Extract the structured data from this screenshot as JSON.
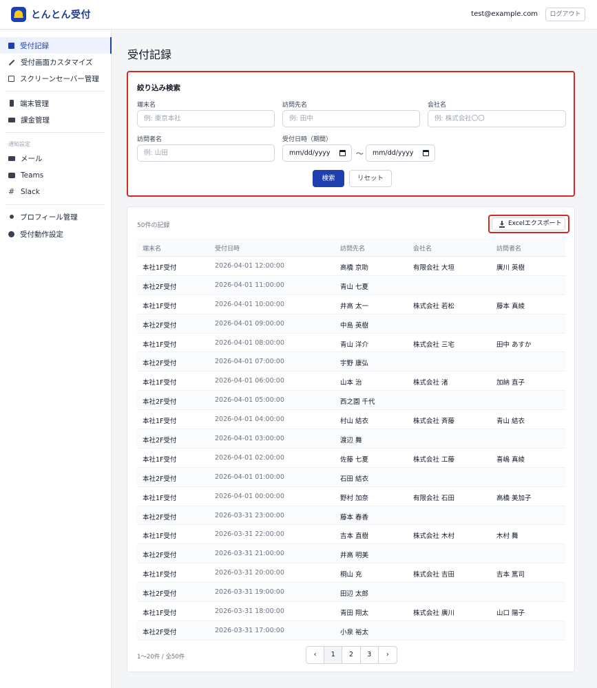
{
  "header": {
    "app_title": "とんとん受付",
    "user_email": "test@example.com",
    "logout_label": "ログアウト"
  },
  "sidebar": {
    "items": [
      {
        "label": "受付記録",
        "icon": "clipboard-icon",
        "active": true
      },
      {
        "label": "受付画面カスタマイズ",
        "icon": "pencil-icon"
      },
      {
        "label": "スクリーンセーバー管理",
        "icon": "image-icon"
      },
      {
        "label": "端末管理",
        "icon": "phone-icon"
      },
      {
        "label": "課金管理",
        "icon": "credit-card-icon"
      },
      {
        "label": "メール",
        "icon": "mail-icon"
      },
      {
        "label": "Teams",
        "icon": "chat-icon"
      },
      {
        "label": "Slack",
        "icon": "hash-icon"
      },
      {
        "label": "プロフィール管理",
        "icon": "user-icon"
      },
      {
        "label": "受付動作設定",
        "icon": "gear-icon"
      }
    ],
    "section_notify": "通知設定"
  },
  "main": {
    "page_title": "受付記録"
  },
  "filter": {
    "title": "絞り込み検索",
    "terminal_label": "端末名",
    "terminal_placeholder": "例: 東京本社",
    "visit_to_label": "訪問先名",
    "visit_to_placeholder": "例: 田中",
    "company_label": "会社名",
    "company_placeholder": "例: 株式会社〇〇",
    "visitor_label": "訪問者名",
    "visitor_placeholder": "例: 山田",
    "date_label": "受付日時（期間）",
    "date_from": "mm/dd/yyyy",
    "date_to": "mm/dd/yyyy",
    "tilde": "〜",
    "search_label": "検索",
    "reset_label": "リセット"
  },
  "table": {
    "record_count": "50件の記録",
    "export_label": "Excelエクスポート",
    "columns": [
      "端末名",
      "受付日時",
      "訪問先名",
      "会社名",
      "訪問者名"
    ],
    "rows": [
      [
        "本社1F受付",
        "2026-04-01 12:00:00",
        "高橋 京助",
        "有限会社 大垣",
        "廣川 英樹"
      ],
      [
        "本社2F受付",
        "2026-04-01 11:00:00",
        "青山 七夏",
        "",
        ""
      ],
      [
        "本社1F受付",
        "2026-04-01 10:00:00",
        "井高 太一",
        "株式会社 若松",
        "藤本 真綾"
      ],
      [
        "本社2F受付",
        "2026-04-01 09:00:00",
        "中島 英樹",
        "",
        ""
      ],
      [
        "本社1F受付",
        "2026-04-01 08:00:00",
        "青山 洋介",
        "株式会社 三宅",
        "田中 あすか"
      ],
      [
        "本社2F受付",
        "2026-04-01 07:00:00",
        "宇野 康弘",
        "",
        ""
      ],
      [
        "本社1F受付",
        "2026-04-01 06:00:00",
        "山本 治",
        "株式会社 渚",
        "加納 直子"
      ],
      [
        "本社2F受付",
        "2026-04-01 05:00:00",
        "西之園 千代",
        "",
        ""
      ],
      [
        "本社1F受付",
        "2026-04-01 04:00:00",
        "村山 結衣",
        "株式会社 斉藤",
        "青山 結衣"
      ],
      [
        "本社2F受付",
        "2026-04-01 03:00:00",
        "渡辺 舞",
        "",
        ""
      ],
      [
        "本社1F受付",
        "2026-04-01 02:00:00",
        "佐藤 七夏",
        "株式会社 工藤",
        "喜嶋 真綾"
      ],
      [
        "本社2F受付",
        "2026-04-01 01:00:00",
        "石田 結衣",
        "",
        ""
      ],
      [
        "本社1F受付",
        "2026-04-01 00:00:00",
        "野村 加奈",
        "有限会社 石田",
        "高橋 美加子"
      ],
      [
        "本社2F受付",
        "2026-03-31 23:00:00",
        "藤本 春香",
        "",
        ""
      ],
      [
        "本社1F受付",
        "2026-03-31 22:00:00",
        "吉本 直樹",
        "株式会社 木村",
        "木村 舞"
      ],
      [
        "本社2F受付",
        "2026-03-31 21:00:00",
        "井高 明美",
        "",
        ""
      ],
      [
        "本社1F受付",
        "2026-03-31 20:00:00",
        "桐山 充",
        "株式会社 吉田",
        "吉本 篤司"
      ],
      [
        "本社2F受付",
        "2026-03-31 19:00:00",
        "田辺 太郎",
        "",
        ""
      ],
      [
        "本社1F受付",
        "2026-03-31 18:00:00",
        "青田 翔太",
        "株式会社 廣川",
        "山口 陽子"
      ],
      [
        "本社2F受付",
        "2026-03-31 17:00:00",
        "小泉 裕太",
        "",
        ""
      ]
    ],
    "page_info": "1〜20件 / 全50件",
    "pagination": {
      "prev": "‹",
      "pages": [
        "1",
        "2",
        "3"
      ],
      "next": "›",
      "current": "1"
    }
  }
}
